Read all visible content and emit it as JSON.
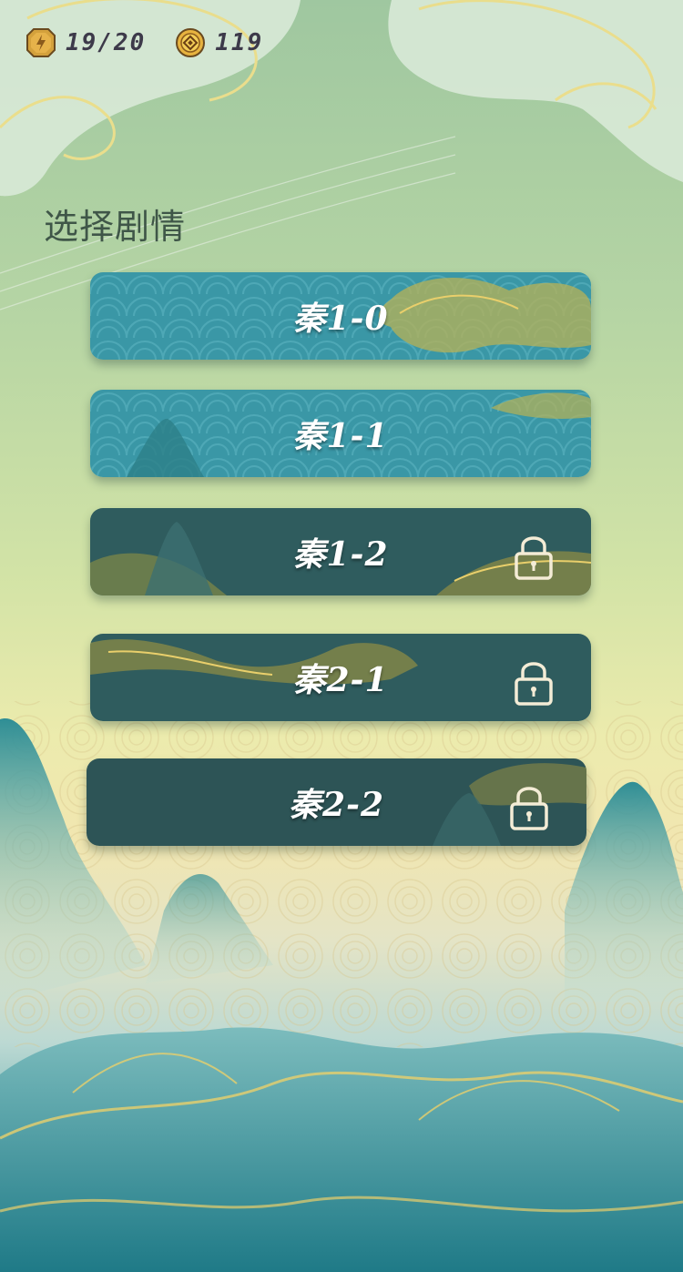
{
  "hud": {
    "energy": {
      "icon": "lightning-badge-icon",
      "value": "19/20"
    },
    "coins": {
      "icon": "coin-icon",
      "value": "119"
    }
  },
  "title": "选择剧情",
  "levels": [
    {
      "label": "秦1-0",
      "locked": false
    },
    {
      "label": "秦1-1",
      "locked": false
    },
    {
      "label": "秦1-2",
      "locked": true
    },
    {
      "label": "秦2-1",
      "locked": true
    },
    {
      "label": "秦2-2",
      "locked": true
    }
  ],
  "colors": {
    "unlocked": "#3a97a6",
    "locked": "#2f5c5e",
    "gold": "#e9cf6b",
    "title": "#3f5648"
  }
}
